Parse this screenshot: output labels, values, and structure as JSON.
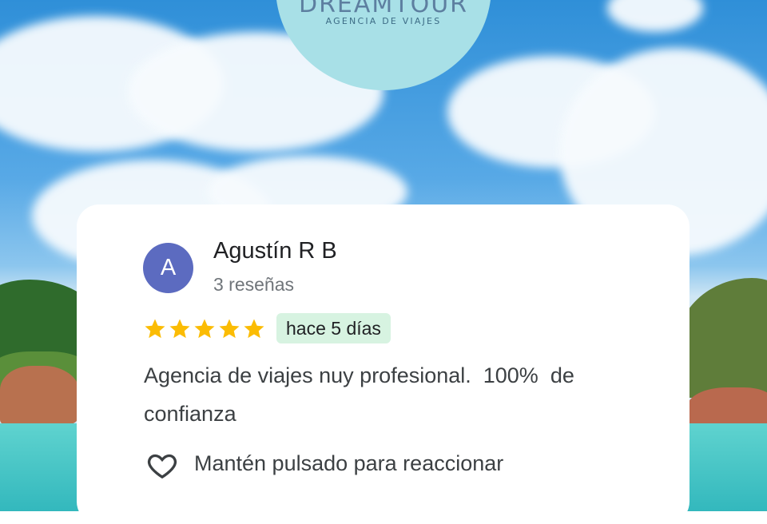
{
  "brand": {
    "name": "DREAMTOUR",
    "tagline": "AGENCIA DE VIAJES"
  },
  "review": {
    "avatar_initial": "A",
    "author": "Agustín R B",
    "review_count": "3 reseñas",
    "rating": 5,
    "rating_max": 5,
    "time": "hace 5 días",
    "text": "Agencia de viajes nuy profesional.  100%  de confianza",
    "react_hint": "Mantén pulsado para reaccionar"
  },
  "colors": {
    "avatar": "#5c6bc0",
    "star": "#fbbc04",
    "badge_bg": "#d7f3e1",
    "logo_bg": "#a8e0e7"
  },
  "icons": [
    "star-icon",
    "heart-icon"
  ]
}
